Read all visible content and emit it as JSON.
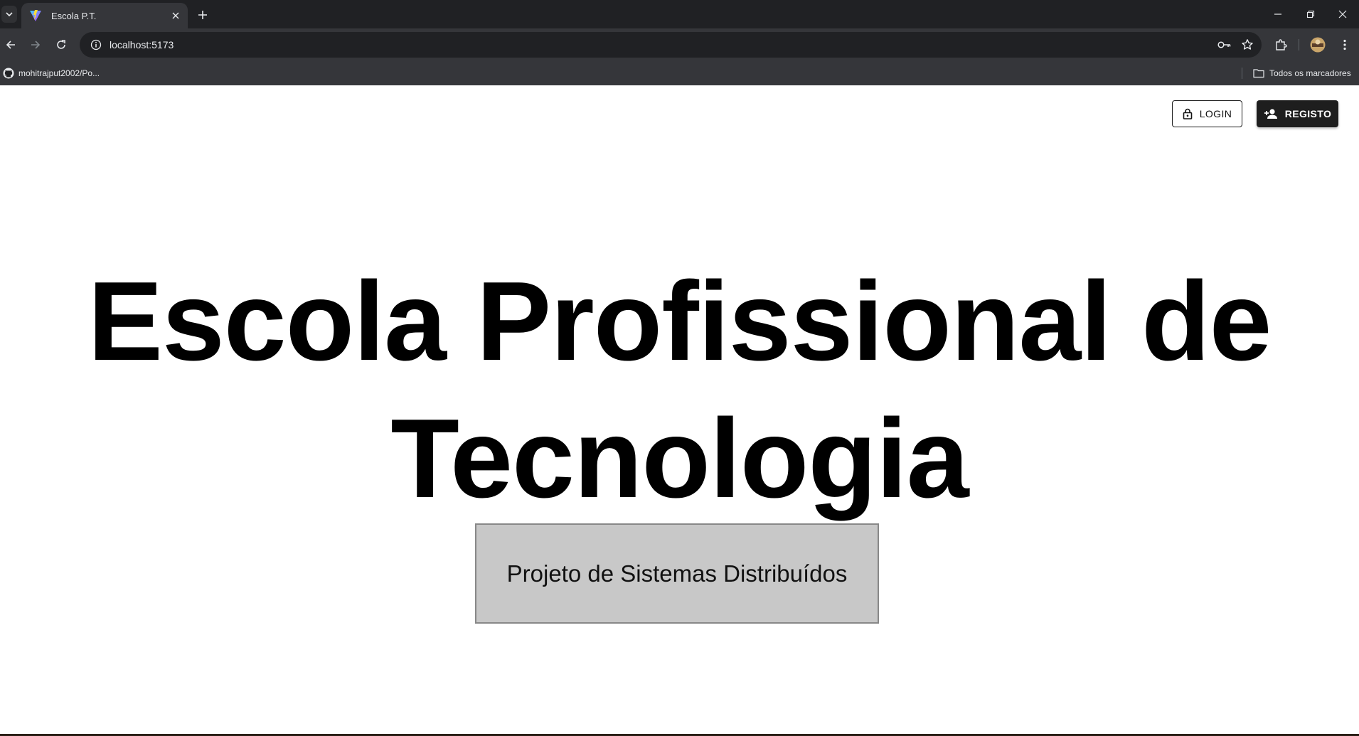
{
  "browser": {
    "tab_title": "Escola P.T.",
    "url": "localhost:5173",
    "bookmarks": [
      {
        "label": "mohitrajput2002/Po..."
      }
    ],
    "all_bookmarks_label": "Todos os marcadores"
  },
  "header": {
    "login_label": "LOGIN",
    "register_label": "REGISTO"
  },
  "hero": {
    "line1": "Escola Profissional de",
    "line2": "Tecnologia"
  },
  "subtitle": "Projeto de Sistemas Distribuídos",
  "colors": {
    "chrome_dark": "#202124",
    "chrome_toolbar": "#35363a",
    "primary_button": "#1e1e1e",
    "subtitle_bg": "#c8c8c8"
  }
}
